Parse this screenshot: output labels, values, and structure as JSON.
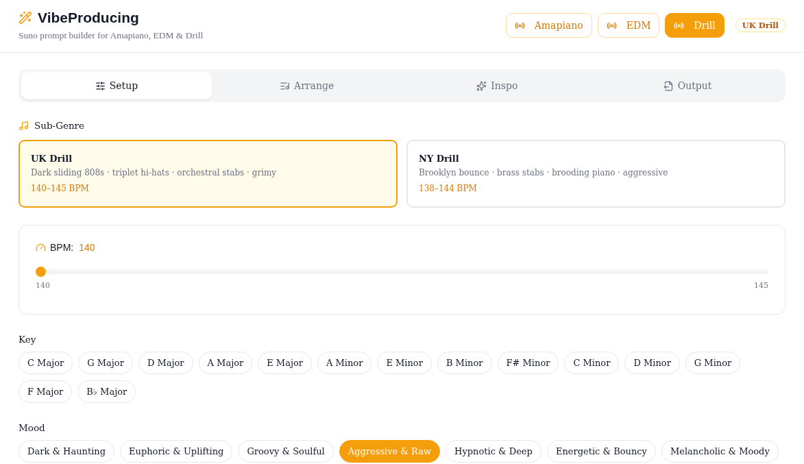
{
  "header": {
    "title": "VibeProducing",
    "subtitle": "Suno prompt builder for Amapiano, EDM & Drill",
    "genres": [
      {
        "label": "Amapiano",
        "selected": false
      },
      {
        "label": "EDM",
        "selected": false
      },
      {
        "label": "Drill",
        "selected": true
      }
    ],
    "badge": "UK Drill"
  },
  "tabs": [
    {
      "label": "Setup",
      "selected": true
    },
    {
      "label": "Arrange",
      "selected": false
    },
    {
      "label": "Inspo",
      "selected": false
    },
    {
      "label": "Output",
      "selected": false
    }
  ],
  "sub_genre": {
    "label": "Sub-Genre",
    "options": [
      {
        "name": "UK Drill",
        "description": "Dark sliding 808s · triplet hi-hats · orchestral stabs · grimy",
        "bpm": "140–145 BPM",
        "selected": true
      },
      {
        "name": "NY Drill",
        "description": "Brooklyn bounce · brass stabs · brooding piano · aggressive",
        "bpm": "138–144 BPM",
        "selected": false
      }
    ]
  },
  "bpm": {
    "label": "BPM:",
    "value": "140",
    "level": 0,
    "min": "140",
    "max": "145"
  },
  "key": {
    "label": "Key",
    "options": [
      {
        "label": "C Major",
        "selected": false
      },
      {
        "label": "G Major",
        "selected": false
      },
      {
        "label": "D Major",
        "selected": false
      },
      {
        "label": "A Major",
        "selected": false
      },
      {
        "label": "E Major",
        "selected": false
      },
      {
        "label": "A Minor",
        "selected": false
      },
      {
        "label": "E Minor",
        "selected": false
      },
      {
        "label": "B Minor",
        "selected": false
      },
      {
        "label": "F# Minor",
        "selected": false
      },
      {
        "label": "C Minor",
        "selected": false
      },
      {
        "label": "D Minor",
        "selected": false
      },
      {
        "label": "G Minor",
        "selected": false
      },
      {
        "label": "F Major",
        "selected": false
      },
      {
        "label": "B♭ Major",
        "selected": false
      }
    ]
  },
  "mood": {
    "label": "Mood",
    "options": [
      {
        "label": "Dark & Haunting",
        "selected": false
      },
      {
        "label": "Euphoric & Uplifting",
        "selected": false
      },
      {
        "label": "Groovy & Soulful",
        "selected": false
      },
      {
        "label": "Aggressive & Raw",
        "selected": true
      },
      {
        "label": "Hypnotic & Deep",
        "selected": false
      },
      {
        "label": "Energetic & Bouncy",
        "selected": false
      },
      {
        "label": "Melancholic & Moody",
        "selected": false
      }
    ]
  }
}
